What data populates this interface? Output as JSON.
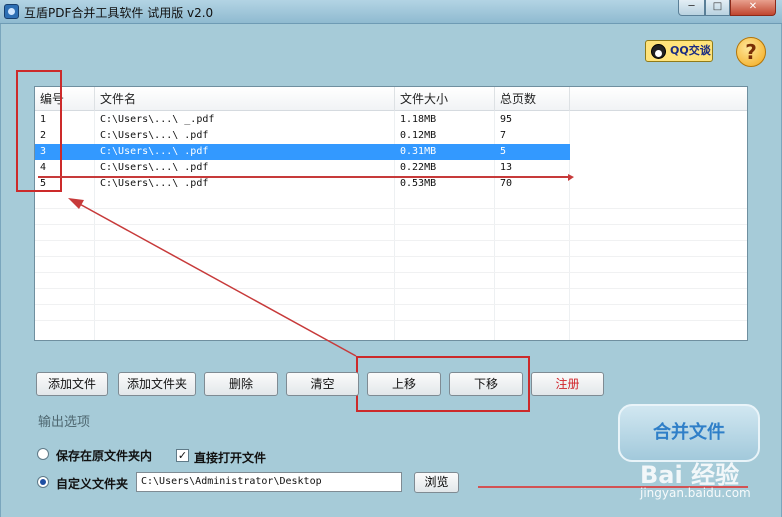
{
  "window": {
    "title": "互盾PDF合并工具软件 试用版 v2.0",
    "min": "─",
    "max": "□",
    "close": "✕"
  },
  "header": {
    "qq_label": "QQ交谈",
    "help_label": "?"
  },
  "table": {
    "columns": [
      "编号",
      "文件名",
      "文件大小",
      "总页数"
    ],
    "rows": [
      {
        "id": "1",
        "name": "C:\\Users\\...\\     _.pdf",
        "size": "1.18MB",
        "pages": "95"
      },
      {
        "id": "2",
        "name": "C:\\Users\\...\\    .pdf",
        "size": "0.12MB",
        "pages": "7"
      },
      {
        "id": "3",
        "name": "C:\\Users\\...\\          .pdf",
        "size": "0.31MB",
        "pages": "5"
      },
      {
        "id": "4",
        "name": "C:\\Users\\...\\       .pdf",
        "size": "0.22MB",
        "pages": "13"
      },
      {
        "id": "5",
        "name": "C:\\Users\\...\\      .pdf",
        "size": "0.53MB",
        "pages": "70"
      }
    ],
    "selected_row": 3
  },
  "buttons": {
    "add_file": "添加文件",
    "add_folder": "添加文件夹",
    "delete": "删除",
    "clear": "清空",
    "move_up": "上移",
    "move_down": "下移",
    "register": "注册",
    "merge": "合并文件"
  },
  "output": {
    "section": "输出选项",
    "option_original": "保存在原文件夹内",
    "open_directly": "直接打开文件",
    "option_custom": "自定义文件夹",
    "custom_path": "C:\\Users\\Administrator\\Desktop",
    "browse": "浏览"
  },
  "watermark": {
    "brand": "Bai 经验",
    "url": "jingyan.baidu.com"
  },
  "colors": {
    "selection": "#3399ff",
    "annotation": "#cc2a2a",
    "register_text": "#d1232a"
  }
}
